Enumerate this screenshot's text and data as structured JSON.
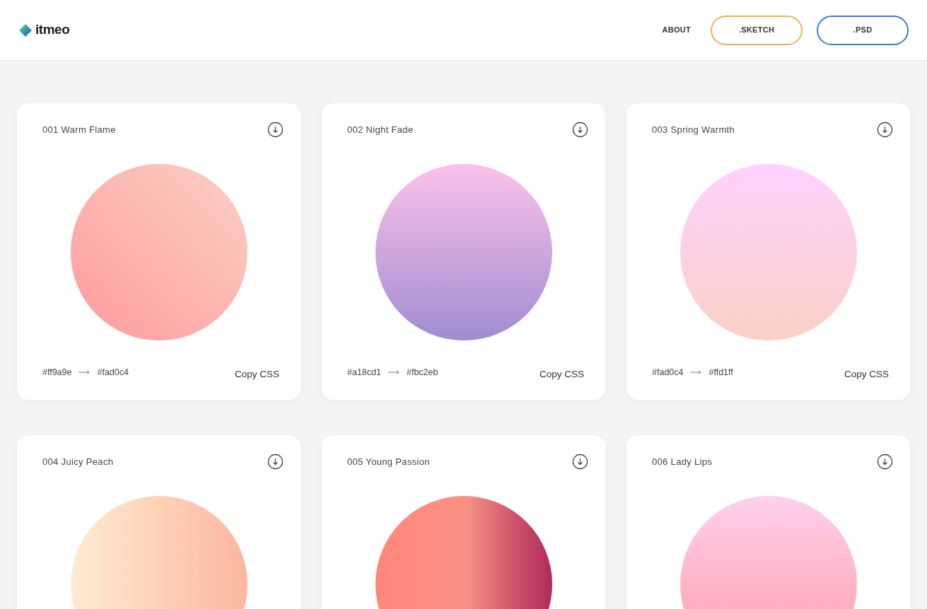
{
  "header": {
    "logo": "itmeo",
    "nav": [
      {
        "kind": "link",
        "label": "ABOUT"
      },
      {
        "kind": "outline",
        "label": ".SKETCH",
        "color": "#eab25a"
      },
      {
        "kind": "outline",
        "label": ".PSD",
        "color": "#3a7bd5"
      }
    ]
  },
  "cards": [
    {
      "title": "001 Warm Flame",
      "from": "#ff9a9e",
      "to": "#fad0c4",
      "action": "Copy CSS"
    },
    {
      "title": "002 Night Fade",
      "from": "#a18cd1",
      "to": "#fbc2eb",
      "action": "Copy CSS"
    },
    {
      "title": "003 Spring Warmth",
      "from": "#fad0c4",
      "to": "#ffd1ff",
      "action": "Copy CSS"
    },
    {
      "title": "004 Juicy Peach"
    },
    {
      "title": "005 Young Passion"
    },
    {
      "title": "006 Lady Lips"
    }
  ]
}
